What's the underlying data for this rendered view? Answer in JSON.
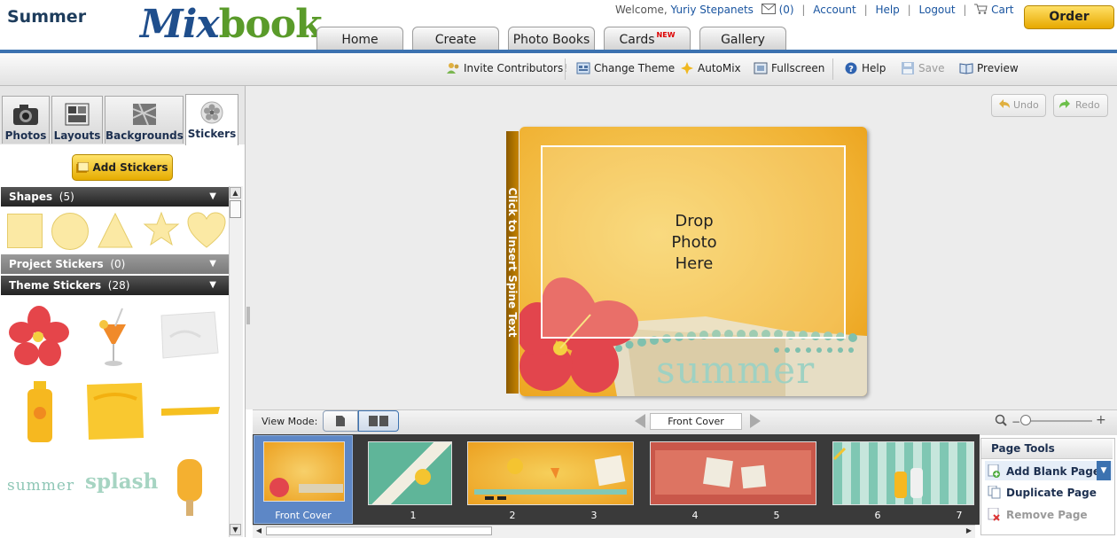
{
  "logo": {
    "part1": "Mix",
    "part2": "book"
  },
  "header": {
    "welcome": "Welcome,",
    "user": "Yuriy Stepanets",
    "messages": "(0)",
    "account": "Account",
    "help": "Help",
    "logout": "Logout",
    "cart": "Cart"
  },
  "nav": {
    "home": "Home",
    "create": "Create",
    "photobooks": "Photo Books",
    "cards": "Cards",
    "cards_badge": "NEW",
    "gallery": "Gallery"
  },
  "toolbar": {
    "project_title": "Summer",
    "invite": "Invite Contributors!",
    "change_theme": "Change Theme",
    "automix": "AutoMix",
    "fullscreen": "Fullscreen",
    "help": "Help",
    "save": "Save",
    "preview": "Preview",
    "order": "Order"
  },
  "panel": {
    "tabs": {
      "photos": "Photos",
      "layouts": "Layouts",
      "backgrounds": "Backgrounds",
      "stickers": "Stickers"
    },
    "add_stickers": "Add Stickers",
    "sections": {
      "shapes": {
        "label": "Shapes",
        "count": "(5)"
      },
      "project": {
        "label": "Project Stickers",
        "count": "(0)"
      },
      "theme": {
        "label": "Theme Stickers",
        "count": "(28)"
      }
    },
    "sticker_words": {
      "summer": "summer",
      "splash": "splash"
    }
  },
  "canvas": {
    "undo": "Undo",
    "redo": "Redo",
    "spine_text": "Click to Insert Spine Text",
    "drop_line1": "Drop",
    "drop_line2": "Photo",
    "drop_line3": "Here",
    "cover_word": "summer"
  },
  "viewbar": {
    "label": "View Mode:",
    "current_page": "Front Cover"
  },
  "filmstrip": {
    "labels": [
      "Front Cover",
      "1",
      "2",
      "3",
      "4",
      "5",
      "6",
      "7"
    ]
  },
  "page_tools": {
    "title": "Page Tools",
    "add_blank": "Add Blank Page",
    "duplicate": "Duplicate Page",
    "remove": "Remove Page"
  }
}
